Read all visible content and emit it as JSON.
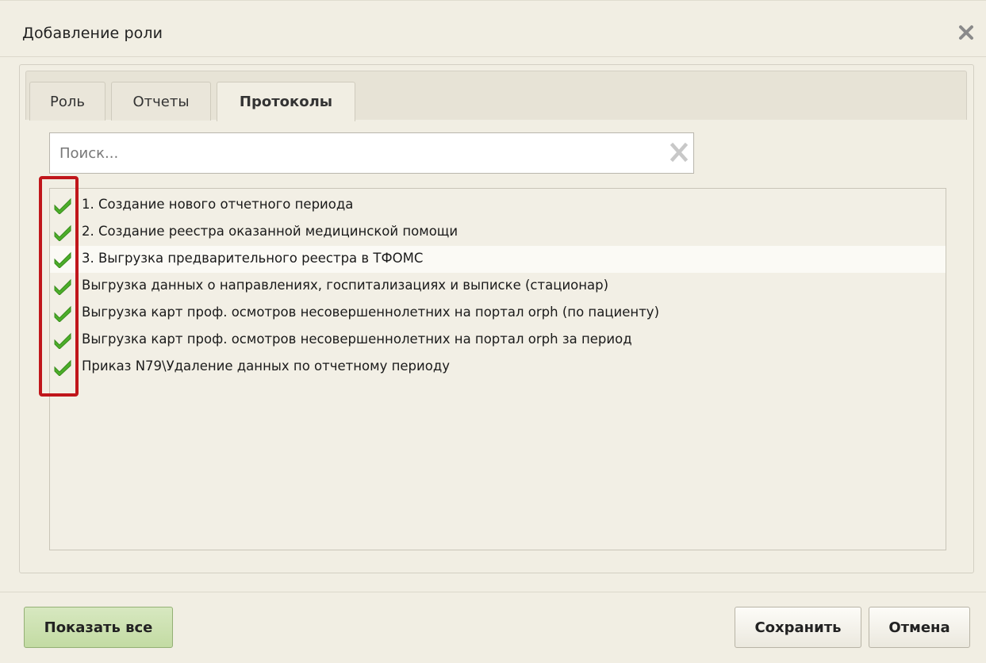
{
  "dialog": {
    "title": "Добавление роли",
    "close_icon": "close-icon"
  },
  "tabs": [
    {
      "label": "Роль",
      "active": false
    },
    {
      "label": "Отчеты",
      "active": false
    },
    {
      "label": "Протоколы",
      "active": true
    }
  ],
  "search": {
    "placeholder": "Поиск...",
    "value": "",
    "clear_icon": "clear-x-icon"
  },
  "protocols": [
    {
      "label": "1. Создание нового отчетного периода",
      "checked": true
    },
    {
      "label": "2. Создание реестра оказанной медицинской помощи",
      "checked": true
    },
    {
      "label": "3. Выгрузка предварительного реестра в ТФОМС",
      "checked": true
    },
    {
      "label": "Выгрузка данных о направлениях, госпитализациях и выписке (стационар)",
      "checked": true
    },
    {
      "label": "Выгрузка карт проф. осмотров несовершеннолетних на портал orph (по пациенту)",
      "checked": true
    },
    {
      "label": "Выгрузка карт проф. осмотров несовершеннолетних на портал orph за период",
      "checked": true
    },
    {
      "label": "Приказ N79\\Удаление данных по отчетному периоду",
      "checked": true
    }
  ],
  "footer": {
    "show_all_label": "Показать все",
    "save_label": "Сохранить",
    "cancel_label": "Отмена"
  },
  "colors": {
    "dialog_bg": "#f1eee3",
    "check_green": "#4cae2a",
    "highlight_red": "#c0161b",
    "show_all_bg": "#c9dfa9"
  }
}
